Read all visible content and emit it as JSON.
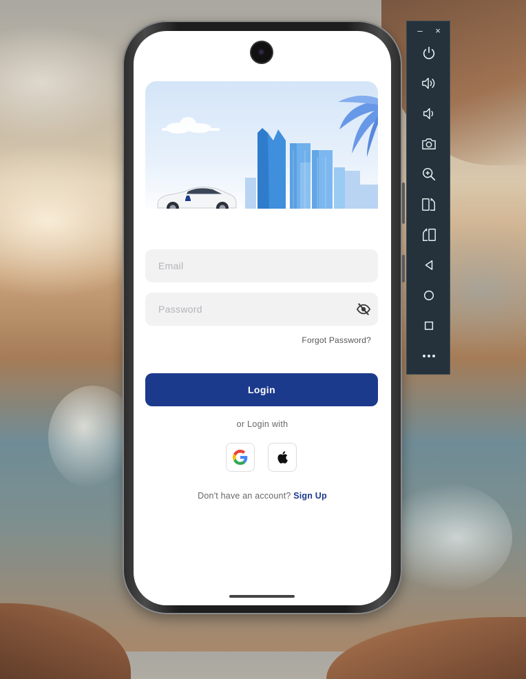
{
  "login_form": {
    "email_placeholder": "Email",
    "password_placeholder": "Password",
    "forgot_password": "Forgot Password?",
    "login_button": "Login",
    "or_login_with": "or Login with",
    "no_account_text": "Don't have an account? ",
    "sign_up_link": "Sign Up"
  },
  "social_logins": [
    {
      "icon": "google-icon"
    },
    {
      "icon": "apple-icon"
    }
  ],
  "emulator_toolbar": {
    "window_controls": [
      "–",
      "×"
    ],
    "buttons": [
      "power-icon",
      "volume-up-icon",
      "volume-down-icon",
      "camera-icon",
      "zoom-icon",
      "rotate-left-icon",
      "rotate-right-icon",
      "back-icon",
      "home-icon",
      "overview-icon",
      "more-icon"
    ]
  },
  "colors": {
    "accent": "#1c3a8c",
    "input_bg": "#f2f2f3",
    "toolbar_bg": "#25323b",
    "icon": "#e6eef2"
  }
}
